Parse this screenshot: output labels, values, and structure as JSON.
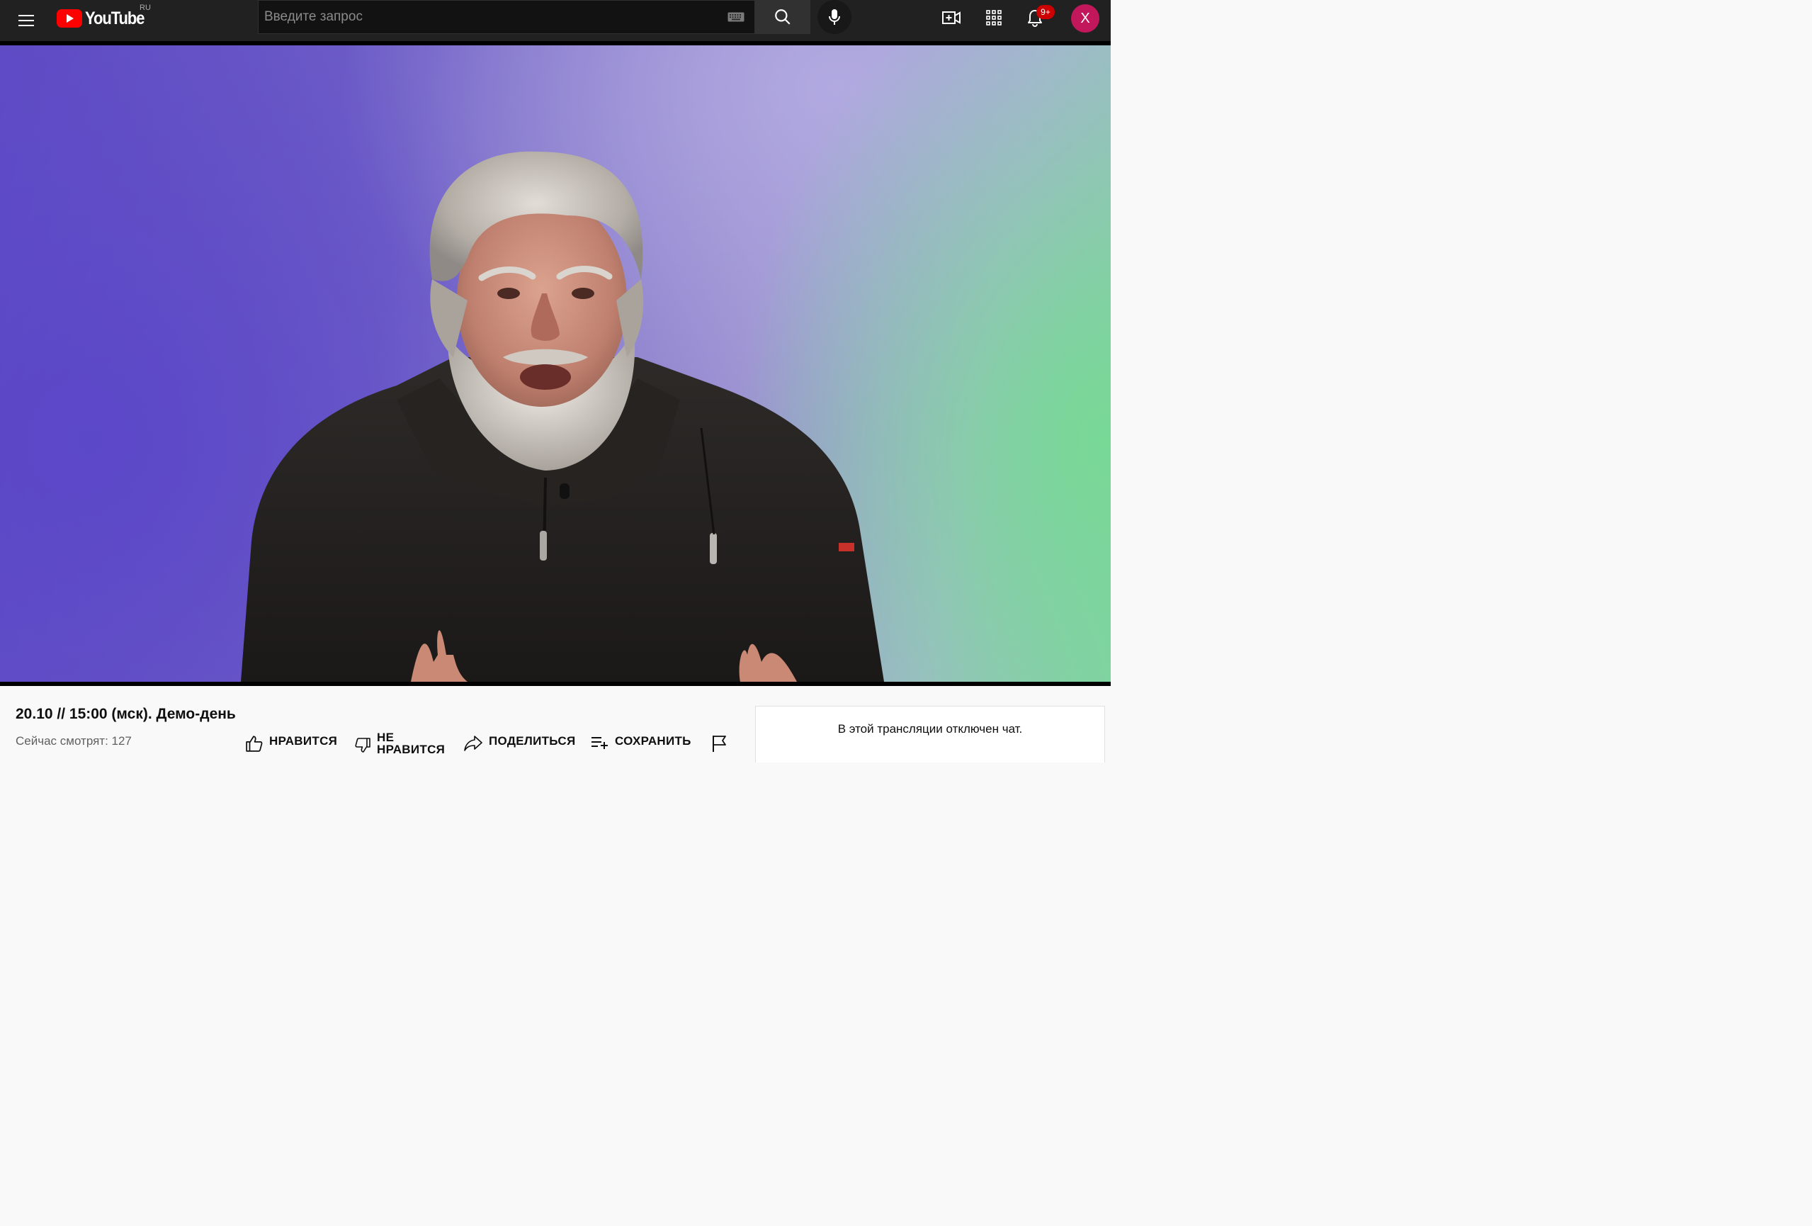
{
  "masthead": {
    "logo_text": "YouTube",
    "region": "RU",
    "search_placeholder": "Введите запрос",
    "notifications_badge": "9+",
    "avatar_letter": "X"
  },
  "video": {
    "title": "20.10 // 15:00 (мск). Демо-день",
    "viewers": "Сейчас смотрят: 127",
    "actions": {
      "like": "НРАВИТСЯ",
      "dislike_line1": "НЕ",
      "dislike_line2": "НРАВИТСЯ",
      "share": "ПОДЕЛИТЬСЯ",
      "save": "СОХРАНИТЬ"
    }
  },
  "chat": {
    "disabled_message": "В этой трансляции отключен чат."
  },
  "colors": {
    "masthead_bg": "#212121",
    "brand_red": "#ff0000",
    "badge_red": "#cc0000",
    "avatar_bg": "#c2185b"
  }
}
